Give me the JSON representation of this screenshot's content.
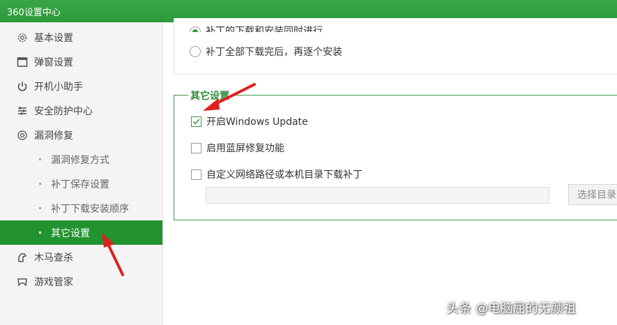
{
  "window": {
    "title": "360设置中心"
  },
  "sidebar": {
    "items": [
      {
        "label": "基本设置",
        "icon": "gear-icon"
      },
      {
        "label": "弹窗设置",
        "icon": "window-icon"
      },
      {
        "label": "开机小助手",
        "icon": "power-timer-icon"
      },
      {
        "label": "安全防护中心",
        "icon": "shield-grid-icon"
      },
      {
        "label": "漏洞修复",
        "icon": "repair-icon"
      }
    ],
    "sub_items": [
      {
        "label": "漏洞修复方式"
      },
      {
        "label": "补丁保存设置"
      },
      {
        "label": "补丁下载安装顺序"
      },
      {
        "label": "其它设置",
        "active": true
      }
    ],
    "items_after": [
      {
        "label": "木马查杀",
        "icon": "trojan-icon"
      },
      {
        "label": "游戏管家",
        "icon": "gamepad-icon"
      }
    ]
  },
  "install_order": {
    "option_partial": "补丁的下载和安装同时进行",
    "option_all": "补丁全部下载完后，再逐个安装",
    "selected": "option_partial"
  },
  "other_settings": {
    "legend": "其它设置",
    "enable_windows_update": {
      "label": "开启Windows Update",
      "checked": true
    },
    "enable_bsod_repair": {
      "label": "启用蓝屏修复功能",
      "checked": false
    },
    "custom_path": {
      "label": "自定义网络路径或本机目录下载补丁",
      "checked": false,
      "value": ""
    },
    "choose_dir_button": "选择目录"
  },
  "watermark": "头条 @电脑屈的无颜祖",
  "colors": {
    "brand_green": "#2e9a3b",
    "active_nav": "#22932f",
    "annotation_red": "#e0201b"
  }
}
